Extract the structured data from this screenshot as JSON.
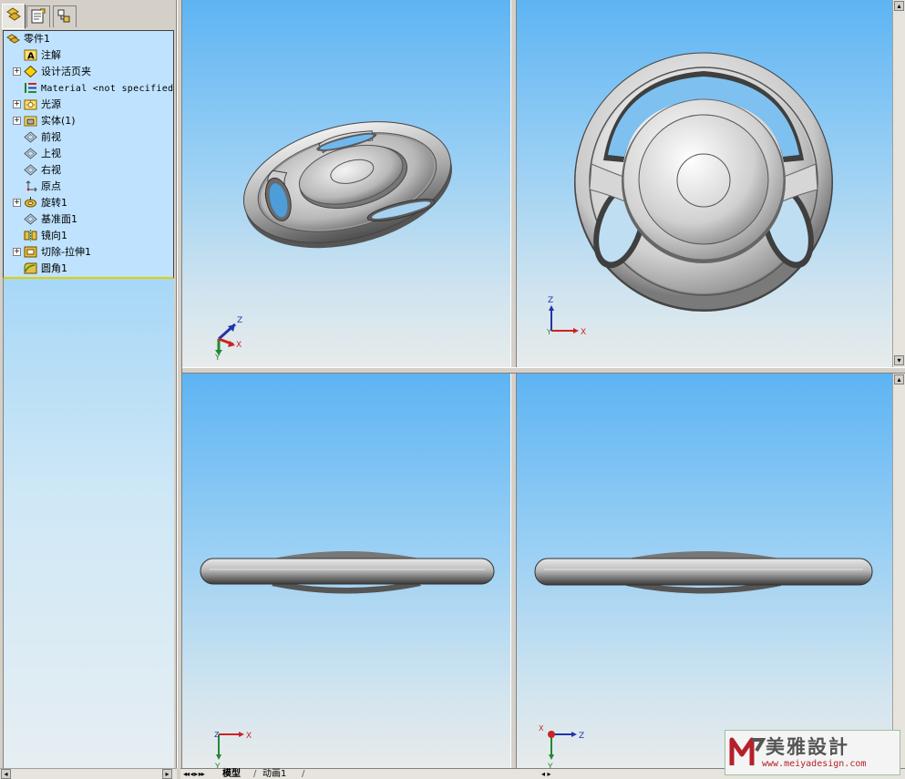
{
  "feature_tree": {
    "part_name": "零件1",
    "items": [
      {
        "label": "注解",
        "icon": "annotation-icon",
        "expandable": false
      },
      {
        "label": "设计活页夹",
        "icon": "design-binder-icon",
        "expandable": true
      },
      {
        "label": "Material <not specified>",
        "icon": "material-icon",
        "expandable": false
      },
      {
        "label": "光源",
        "icon": "lighting-icon",
        "expandable": true
      },
      {
        "label": "实体(1)",
        "icon": "solid-bodies-icon",
        "expandable": true
      },
      {
        "label": "前视",
        "icon": "plane-icon",
        "expandable": false
      },
      {
        "label": "上视",
        "icon": "plane-icon",
        "expandable": false
      },
      {
        "label": "右视",
        "icon": "plane-icon",
        "expandable": false
      },
      {
        "label": "原点",
        "icon": "origin-icon",
        "expandable": false
      },
      {
        "label": "旋转1",
        "icon": "revolve-icon",
        "expandable": true
      },
      {
        "label": "基准面1",
        "icon": "plane-icon",
        "expandable": false
      },
      {
        "label": "镜向1",
        "icon": "mirror-icon",
        "expandable": false
      },
      {
        "label": "切除-拉伸1",
        "icon": "cut-extrude-icon",
        "expandable": true
      },
      {
        "label": "圆角1",
        "icon": "fillet-icon",
        "expandable": false
      }
    ]
  },
  "panel_tabs": [
    "feature-manager-icon",
    "property-manager-icon",
    "configuration-manager-icon"
  ],
  "viewports": {
    "top_left": {
      "view": "isometric",
      "triad": {
        "x": "X",
        "y": "Y",
        "z": "Z"
      }
    },
    "top_right": {
      "view": "front",
      "triad": {
        "x": "X",
        "y": "Y",
        "z": "Z"
      }
    },
    "bottom_left": {
      "view": "top",
      "triad": {
        "x": "X",
        "y": "Y",
        "z": "Z"
      }
    },
    "bottom_right": {
      "view": "right",
      "triad": {
        "x": "X",
        "y": "Y",
        "z": "Z"
      }
    }
  },
  "bottom_tabs": [
    "模型",
    "动画1"
  ],
  "watermark": {
    "title": "美雅設計",
    "url": "www.meiyadesign.com"
  },
  "colors": {
    "tree_bg": "#bfe3ff",
    "viewport_top": "#5db4f3",
    "viewport_bottom": "#e8ebeb",
    "axis_x": "#cc2222",
    "axis_y": "#228833",
    "axis_z": "#2233aa"
  }
}
